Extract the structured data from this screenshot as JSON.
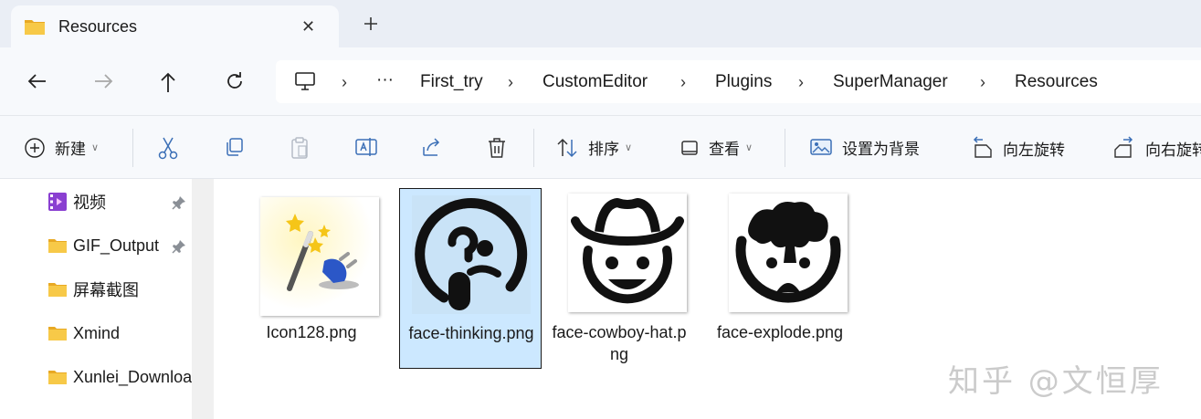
{
  "tab": {
    "title": "Resources",
    "close_glyph": "✕",
    "new_tab_icon": "plus-icon"
  },
  "nav": {
    "back_icon": "arrow-left-icon",
    "forward_icon": "arrow-right-icon",
    "up_icon": "arrow-up-icon",
    "refresh_icon": "refresh-icon"
  },
  "address": {
    "root_icon": "monitor-icon",
    "overflow": "···",
    "separator": "›",
    "crumbs": [
      "First_try",
      "CustomEditor",
      "Plugins",
      "SuperManager",
      "Resources"
    ]
  },
  "toolbar": {
    "new_label": "新建",
    "sort_label": "排序",
    "view_label": "查看",
    "set_bg_label": "设置为背景",
    "rotate_left_label": "向左旋转",
    "rotate_right_label": "向右旋转"
  },
  "sidebar": {
    "items": [
      {
        "label": "视频",
        "pinned": true
      },
      {
        "label": "GIF_Output",
        "pinned": true
      },
      {
        "label": "屏幕截图",
        "pinned": false
      },
      {
        "label": "Xmind",
        "pinned": false
      },
      {
        "label": "Xunlei_Download",
        "pinned": false
      }
    ]
  },
  "files": [
    {
      "name": "Icon128.png",
      "icon": "magic-wand-plug-icon",
      "selected": false
    },
    {
      "name": "face-thinking.png",
      "icon": "face-thinking-icon",
      "selected": true
    },
    {
      "name": "face-cowboy-hat.png",
      "icon": "face-cowboy-hat-icon",
      "selected": false
    },
    {
      "name": "face-explode.png",
      "icon": "face-explode-icon",
      "selected": false
    }
  ],
  "watermark": "知乎 @文恒厚",
  "colors": {
    "selection": "#cce8ff",
    "folder": "#f7c948",
    "accent": "#1c66d4"
  }
}
